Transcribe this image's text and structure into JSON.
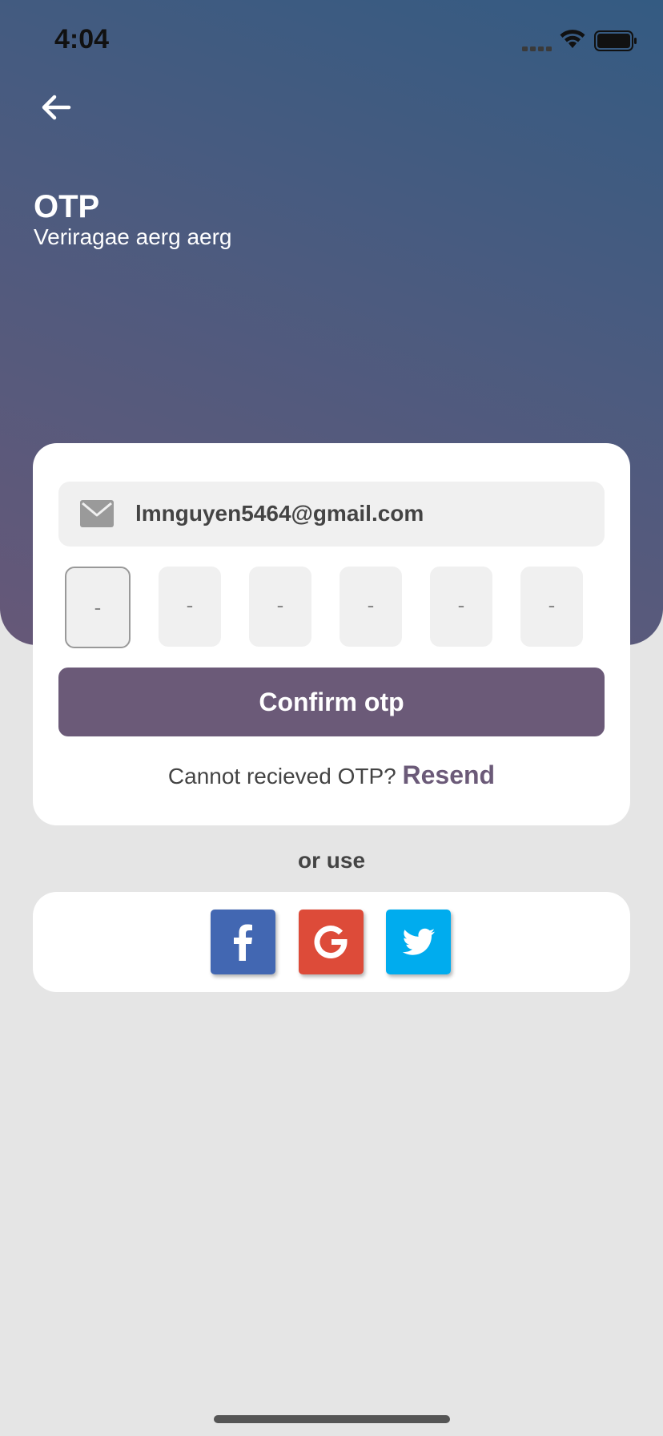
{
  "status_bar": {
    "time": "4:04"
  },
  "header": {
    "back_icon": "arrow-left-icon",
    "title": "OTP",
    "subtitle": "Veriragae aerg aerg"
  },
  "form": {
    "email_icon": "mail-icon",
    "email_value": "lmnguyen5464@gmail.com",
    "otp_digits": [
      "-",
      "-",
      "-",
      "-",
      "-",
      "-"
    ],
    "confirm_label": "Confirm otp",
    "resend_prompt": "Cannot recieved OTP?",
    "resend_label": "Resend"
  },
  "social": {
    "divider_label": "or use",
    "buttons": [
      {
        "icon": "facebook-icon",
        "color": "#4267b2"
      },
      {
        "icon": "google-icon",
        "color": "#dd4b39"
      },
      {
        "icon": "twitter-icon",
        "color": "#00acee"
      }
    ]
  },
  "colors": {
    "accent": "#6b5a78",
    "gradient_top": "#345b82",
    "gradient_bottom": "#665878",
    "background": "#e5e5e5"
  }
}
